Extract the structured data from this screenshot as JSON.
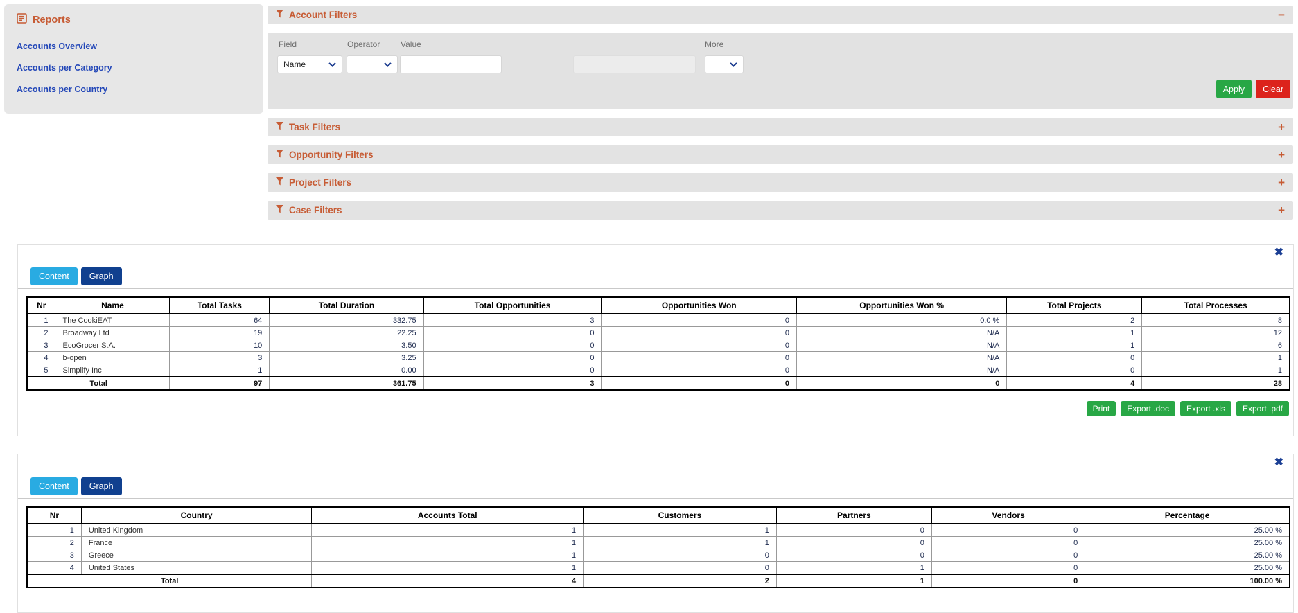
{
  "icons": {
    "close": "✖",
    "collapse": "−",
    "expand": "+"
  },
  "sidebar": {
    "title": "Reports",
    "items": [
      {
        "label": "Accounts Overview"
      },
      {
        "label": "Accounts per Category"
      },
      {
        "label": "Accounts per Country"
      }
    ]
  },
  "account_filters": {
    "title": "Account Filters",
    "field_label": "Field",
    "field_value": "Name",
    "operator_label": "Operator",
    "operator_value": "",
    "value_label": "Value",
    "value_text": "",
    "value2_text": "",
    "more_label": "More",
    "more_value": "",
    "apply_label": "Apply",
    "clear_label": "Clear"
  },
  "collapsed_filters": [
    {
      "title": "Task Filters"
    },
    {
      "title": "Opportunity Filters"
    },
    {
      "title": "Project Filters"
    },
    {
      "title": "Case Filters"
    }
  ],
  "report_accounts_overview": {
    "tabs": [
      {
        "label": "Content"
      },
      {
        "label": "Graph"
      }
    ],
    "columns": [
      "Nr",
      "Name",
      "Total Tasks",
      "Total Duration",
      "Total Opportunities",
      "Opportunities Won",
      "Opportunities Won %",
      "Total Projects",
      "Total Processes"
    ],
    "rows": [
      [
        "1",
        "The CookiEAT",
        "64",
        "332.75",
        "3",
        "0",
        "0.0 %",
        "2",
        "8"
      ],
      [
        "2",
        "Broadway Ltd",
        "19",
        "22.25",
        "0",
        "0",
        "N/A",
        "1",
        "12"
      ],
      [
        "3",
        "EcoGrocer S.A.",
        "10",
        "3.50",
        "0",
        "0",
        "N/A",
        "1",
        "6"
      ],
      [
        "4",
        "b-open",
        "3",
        "3.25",
        "0",
        "0",
        "N/A",
        "0",
        "1"
      ],
      [
        "5",
        "Simplify Inc",
        "1",
        "0.00",
        "0",
        "0",
        "N/A",
        "0",
        "1"
      ]
    ],
    "total": [
      "Total",
      "97",
      "361.75",
      "3",
      "0",
      "0",
      "4",
      "28"
    ],
    "actions": [
      "Print",
      "Export .doc",
      "Export .xls",
      "Export .pdf"
    ]
  },
  "report_accounts_per_country": {
    "tabs": [
      {
        "label": "Content"
      },
      {
        "label": "Graph"
      }
    ],
    "columns": [
      "Nr",
      "Country",
      "Accounts Total",
      "Customers",
      "Partners",
      "Vendors",
      "Percentage"
    ],
    "rows": [
      [
        "1",
        "United Kingdom",
        "1",
        "1",
        "0",
        "0",
        "25.00 %"
      ],
      [
        "2",
        "France",
        "1",
        "1",
        "0",
        "0",
        "25.00 %"
      ],
      [
        "3",
        "Greece",
        "1",
        "0",
        "0",
        "0",
        "25.00 %"
      ],
      [
        "4",
        "United States",
        "1",
        "0",
        "1",
        "0",
        "25.00 %"
      ]
    ],
    "total": [
      "Total",
      "4",
      "2",
      "1",
      "0",
      "100.00 %"
    ]
  }
}
